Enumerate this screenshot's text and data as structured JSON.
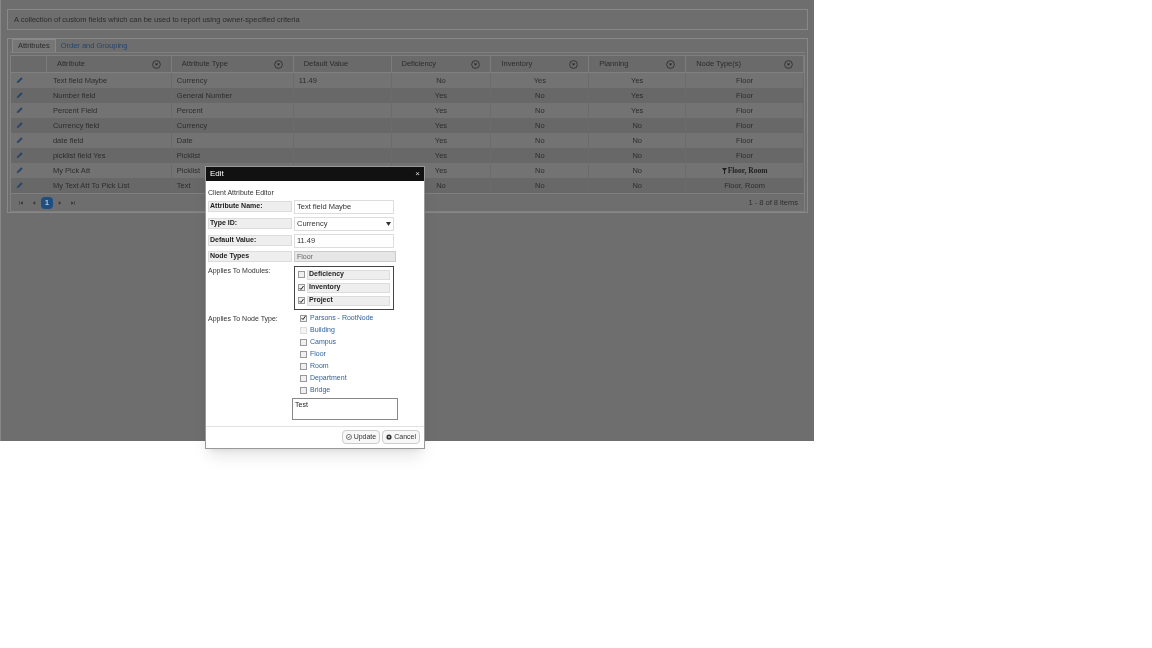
{
  "description": "A collection of custom fields which can be used to report using owner-specified criteria",
  "tabs": [
    {
      "label": "Attributes",
      "selected": true
    },
    {
      "label": "Order and Grouping",
      "selected": false
    }
  ],
  "table": {
    "columns": [
      {
        "label": "Attribute",
        "filter": true
      },
      {
        "label": "Attribute Type",
        "filter": true
      },
      {
        "label": "Default Value",
        "filter": false
      },
      {
        "label": "Deficiency",
        "filter": true
      },
      {
        "label": "Inventory",
        "filter": true
      },
      {
        "label": "Planning",
        "filter": true
      },
      {
        "label": "Node Type(s)",
        "filter": true
      }
    ],
    "rows": [
      {
        "cells": [
          "Text field Maybe",
          "Currency",
          "11.49",
          "No",
          "Yes",
          "Yes",
          "Floor"
        ],
        "filtered": false
      },
      {
        "cells": [
          "Number field",
          "General Number",
          "",
          "Yes",
          "No",
          "Yes",
          "Floor"
        ],
        "filtered": false
      },
      {
        "cells": [
          "Percent Field",
          "Percent",
          "",
          "Yes",
          "No",
          "Yes",
          "Floor"
        ],
        "filtered": false
      },
      {
        "cells": [
          "Currency field",
          "Currency",
          "",
          "Yes",
          "No",
          "No",
          "Floor"
        ],
        "filtered": false
      },
      {
        "cells": [
          "date field",
          "Date",
          "",
          "Yes",
          "No",
          "No",
          "Floor"
        ],
        "filtered": false
      },
      {
        "cells": [
          "picklist field Yes",
          "Picklist",
          "",
          "Yes",
          "No",
          "No",
          "Floor"
        ],
        "filtered": false
      },
      {
        "cells": [
          "My Pick Att",
          "Picklist",
          "",
          "Yes",
          "No",
          "No",
          "Floor, Room"
        ],
        "filtered": true
      },
      {
        "cells": [
          "My Text Att To Pick List",
          "Text",
          "",
          "No",
          "No",
          "No",
          "Floor, Room"
        ],
        "filtered": false
      }
    ]
  },
  "pager": {
    "pages": [
      {
        "label": "1",
        "selected": true
      }
    ],
    "summary": "1 - 8 of 8 items"
  },
  "dialog": {
    "title": "Edit",
    "close": "×",
    "subtitle": "Client Attribute Editor",
    "fields": [
      {
        "label": "Attribute Name:",
        "value": "Text field Maybe",
        "kind": "text"
      },
      {
        "label": "Type ID:",
        "value": "Currency",
        "kind": "select"
      },
      {
        "label": "Default Value:",
        "value": "11.49",
        "kind": "text"
      },
      {
        "label": "Node Types",
        "value": "Floor",
        "kind": "readonly"
      }
    ],
    "modules_label": "Applies To Modules:",
    "modules": [
      {
        "label": "Deficiency",
        "checked": false
      },
      {
        "label": "Inventory",
        "checked": true
      },
      {
        "label": "Project",
        "checked": true
      }
    ],
    "node_types_label": "Applies To Node Type:",
    "node_types": [
      {
        "label": "Parsons - RootNode",
        "checked": true,
        "disabled": false
      },
      {
        "label": "Building",
        "checked": false,
        "disabled": true
      },
      {
        "label": "Campus",
        "checked": false,
        "disabled": false
      },
      {
        "label": "Floor",
        "checked": false,
        "disabled": false
      },
      {
        "label": "Room",
        "checked": false,
        "disabled": false
      },
      {
        "label": "Department",
        "checked": false,
        "disabled": false
      },
      {
        "label": "Bridge",
        "checked": false,
        "disabled": false
      }
    ],
    "notes": "Test",
    "buttons": [
      {
        "label": "Update",
        "kind": "update"
      },
      {
        "label": "Cancel",
        "kind": "cancel"
      }
    ]
  }
}
